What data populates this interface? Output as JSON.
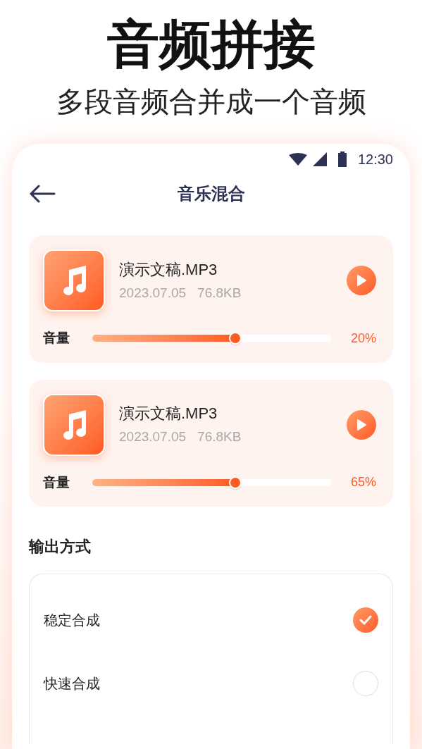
{
  "headline": "音频拼接",
  "subtitle": "多段音频合并成一个音频",
  "status_bar": {
    "time": "12:30"
  },
  "nav": {
    "title": "音乐混合"
  },
  "tracks": [
    {
      "name": "演示文稿.MP3",
      "date": "2023.07.05",
      "size": "76.8KB",
      "volume_label": "音量",
      "level": 0.6,
      "reading": "20%"
    },
    {
      "name": "演示文稿.MP3",
      "date": "2023.07.05",
      "size": "76.8KB",
      "volume_label": "音量",
      "level": 0.6,
      "reading": "65%"
    }
  ],
  "output": {
    "title": "输出方式",
    "options": [
      {
        "label": "稳定合成",
        "selected": true
      },
      {
        "label": "快速合成",
        "selected": false
      }
    ]
  }
}
